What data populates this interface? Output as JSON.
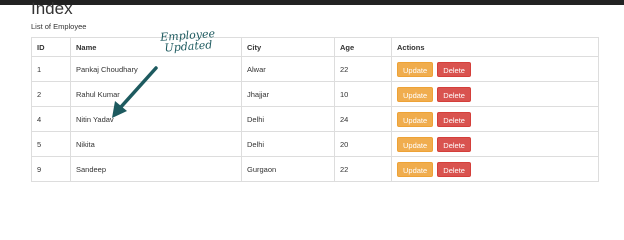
{
  "page": {
    "title": "Index",
    "subtitle": "List of Employee"
  },
  "table": {
    "columns": [
      "ID",
      "Name",
      "City",
      "Age",
      "Actions"
    ],
    "rows": [
      {
        "id": "1",
        "name": "Pankaj Choudhary",
        "city": "Alwar",
        "age": "22"
      },
      {
        "id": "2",
        "name": "Rahul Kumar",
        "city": "Jhajjar",
        "age": "10"
      },
      {
        "id": "4",
        "name": "Nitin Yadav",
        "city": "Delhi",
        "age": "24"
      },
      {
        "id": "5",
        "name": "Nikita",
        "city": "Delhi",
        "age": "20"
      },
      {
        "id": "9",
        "name": "Sandeep",
        "city": "Gurgaon",
        "age": "22"
      }
    ],
    "update_label": "Update",
    "delete_label": "Delete"
  },
  "annotation": {
    "line1": "Employee",
    "line2": "Updated"
  },
  "colors": {
    "update_button": "#f0ad4e",
    "delete_button": "#d9534f",
    "annotation": "#1d5a5f"
  }
}
